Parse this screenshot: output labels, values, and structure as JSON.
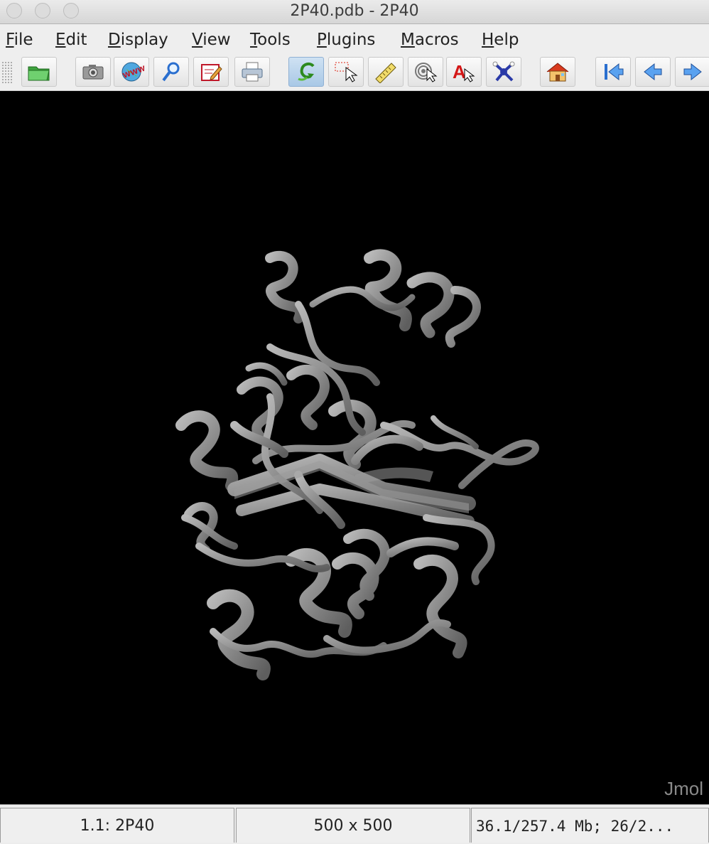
{
  "window": {
    "title": "2P40.pdb - 2P40"
  },
  "menubar": {
    "items": [
      {
        "label_key": "F",
        "label_rest": "ile"
      },
      {
        "label_key": "E",
        "label_rest": "dit"
      },
      {
        "label_key": "D",
        "label_rest": "isplay"
      },
      {
        "label_key": "V",
        "label_rest": "iew"
      },
      {
        "label_key": "T",
        "label_rest": "ools"
      },
      {
        "label_key": "P",
        "label_rest": "lugins"
      },
      {
        "label_key": "M",
        "label_rest": "acros"
      },
      {
        "label_key": "H",
        "label_rest": "elp"
      }
    ]
  },
  "toolbar": {
    "buttons": [
      {
        "icon": "open-folder-icon"
      },
      {
        "icon": "camera-icon"
      },
      {
        "icon": "www-globe-icon"
      },
      {
        "icon": "magnifier-icon"
      },
      {
        "icon": "edit-script-icon"
      },
      {
        "icon": "printer-icon"
      },
      {
        "icon": "rotate-icon",
        "active": true
      },
      {
        "icon": "select-pointer-icon"
      },
      {
        "icon": "ruler-icon"
      },
      {
        "icon": "pick-center-icon"
      },
      {
        "icon": "label-pointer-icon"
      },
      {
        "icon": "molecule-icon"
      },
      {
        "icon": "home-icon"
      },
      {
        "icon": "first-frame-icon"
      },
      {
        "icon": "previous-frame-icon"
      },
      {
        "icon": "next-frame-icon"
      }
    ]
  },
  "viewer": {
    "background_color": "#000000",
    "ribbon_color": "#8c8c8c",
    "watermark": "Jmol"
  },
  "statusbar": {
    "model": "1.1: 2P40",
    "size": "500 x 500",
    "memory": "36.1/257.4 Mb;  26/2..."
  }
}
